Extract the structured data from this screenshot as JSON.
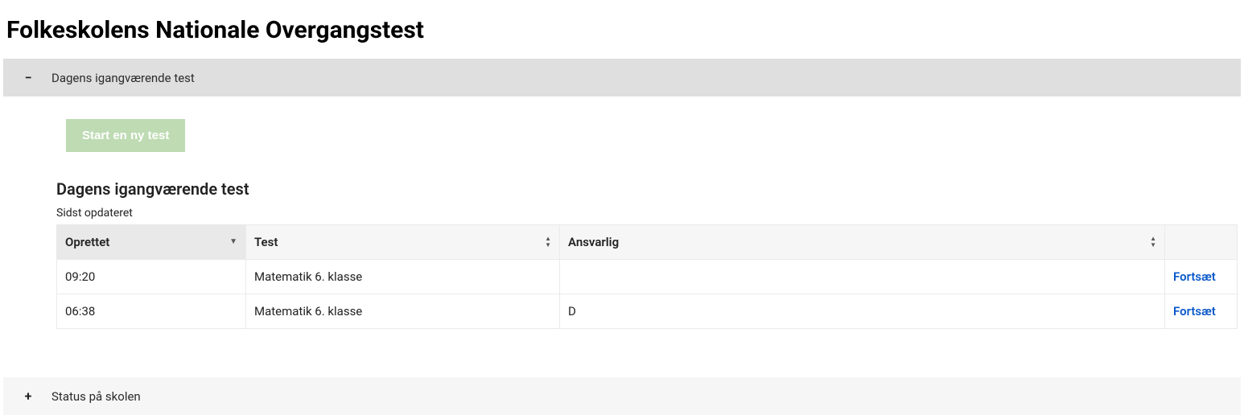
{
  "page_title": "Folkeskolens Nationale Overgangstest",
  "accordion_open": {
    "icon": "−",
    "label": "Dagens igangværende test"
  },
  "accordion_closed": {
    "icon": "+",
    "label": "Status på skolen"
  },
  "start_button_label": "Start en ny test",
  "section_heading": "Dagens igangværende test",
  "last_updated_label": "Sidst opdateret",
  "table": {
    "headers": {
      "created": "Oprettet",
      "test": "Test",
      "responsible": "Ansvarlig",
      "actions": ""
    },
    "rows": [
      {
        "created": "09:20",
        "test": "Matematik 6. klasse",
        "responsible": "",
        "action": "Fortsæt"
      },
      {
        "created": "06:38",
        "test": "Matematik 6. klasse",
        "responsible": "D",
        "action": "Fortsæt"
      }
    ]
  }
}
